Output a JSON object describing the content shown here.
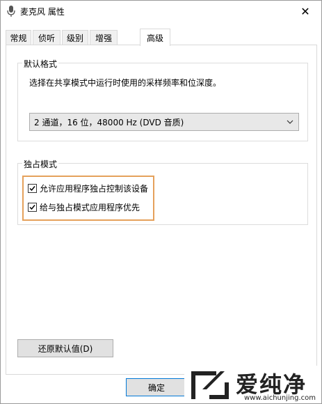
{
  "window": {
    "title": "麦克风 属性",
    "close_glyph": "✕"
  },
  "tabs": [
    {
      "label": "常规",
      "active": false
    },
    {
      "label": "侦听",
      "active": false
    },
    {
      "label": "级别",
      "active": false
    },
    {
      "label": "增强",
      "active": false
    },
    {
      "label": "高级",
      "active": true
    }
  ],
  "default_format": {
    "title": "默认格式",
    "description": "选择在共享模式中运行时使用的采样频率和位深度。",
    "selected": "2 通道，16 位，48000 Hz (DVD 音质)"
  },
  "exclusive_mode": {
    "title": "独占模式",
    "options": [
      {
        "label": "允许应用程序独占控制该设备",
        "checked": true
      },
      {
        "label": "给与独占模式应用程序优先",
        "checked": true
      }
    ],
    "highlight_color": "#e5a15b"
  },
  "buttons": {
    "restore_defaults": "还原默认值(D)",
    "ok": "确定"
  },
  "watermark": {
    "brand": "爱纯净",
    "url": "www.aichunjing.com"
  },
  "icons": {
    "window_icon": "microphone-icon",
    "dropdown_icon": "chevron-down-icon",
    "check_icon": "checkmark-icon"
  }
}
